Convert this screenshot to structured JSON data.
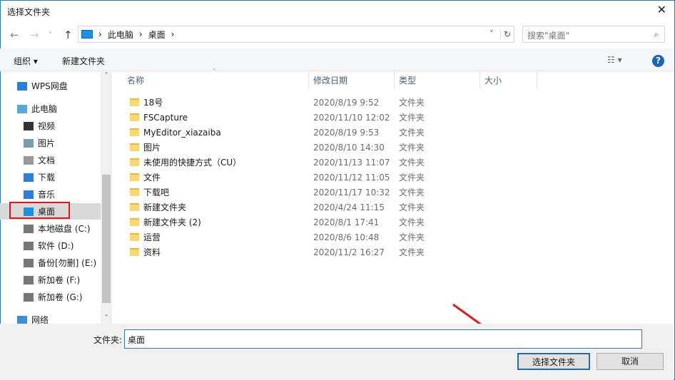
{
  "title": "选择文件夹",
  "address": {
    "crumbs": [
      "此电脑",
      "桌面"
    ],
    "search_placeholder": "搜索\"桌面\""
  },
  "toolbar": {
    "organize": "组织 ▾",
    "new_folder": "新建文件夹",
    "help": "?"
  },
  "sidebar": [
    {
      "label": "WPS网盘",
      "icon": "cloud-icon",
      "color": "#2a7fd6"
    },
    {
      "label": "此电脑",
      "icon": "computer-icon",
      "color": "#5aa7e0"
    },
    {
      "label": "视频",
      "icon": "video-icon",
      "color": "#333"
    },
    {
      "label": "图片",
      "icon": "picture-icon",
      "color": "#7a9bb0"
    },
    {
      "label": "文档",
      "icon": "document-icon",
      "color": "#999"
    },
    {
      "label": "下载",
      "icon": "download-icon",
      "color": "#2f7ed8"
    },
    {
      "label": "音乐",
      "icon": "music-icon",
      "color": "#2f7ed8"
    },
    {
      "label": "桌面",
      "icon": "desktop-icon",
      "color": "#1e90e0"
    },
    {
      "label": "本地磁盘 (C:)",
      "icon": "drive-icon",
      "color": "#777"
    },
    {
      "label": "软件 (D:)",
      "icon": "drive-icon",
      "color": "#777"
    },
    {
      "label": "备份[勿删] (E:)",
      "icon": "drive-icon",
      "color": "#777"
    },
    {
      "label": "新加卷 (F:)",
      "icon": "drive-icon",
      "color": "#777"
    },
    {
      "label": "新加卷 (G:)",
      "icon": "drive-icon",
      "color": "#777"
    },
    {
      "label": "网络",
      "icon": "network-icon",
      "color": "#3c8fd8"
    }
  ],
  "columns": [
    "名称",
    "修改日期",
    "类型",
    "大小"
  ],
  "files": [
    {
      "name": "18号",
      "date": "2020/8/19 9:52",
      "type": "文件夹"
    },
    {
      "name": "FSCapture",
      "date": "2020/11/10 12:02",
      "type": "文件夹"
    },
    {
      "name": "MyEditor_xiazaiba",
      "date": "2020/8/19 9:53",
      "type": "文件夹"
    },
    {
      "name": "图片",
      "date": "2020/8/10 14:30",
      "type": "文件夹"
    },
    {
      "name": "未使用的快捷方式（CU）",
      "date": "2020/11/13 11:07",
      "type": "文件夹"
    },
    {
      "name": "文件",
      "date": "2020/11/12 11:05",
      "type": "文件夹"
    },
    {
      "name": "下载吧",
      "date": "2020/11/17 10:32",
      "type": "文件夹"
    },
    {
      "name": "新建文件夹",
      "date": "2020/4/24 11:15",
      "type": "文件夹"
    },
    {
      "name": "新建文件夹 (2)",
      "date": "2020/8/1 17:41",
      "type": "文件夹"
    },
    {
      "name": "运营",
      "date": "2020/8/6 10:48",
      "type": "文件夹"
    },
    {
      "name": "资料",
      "date": "2020/11/2 16:27",
      "type": "文件夹"
    }
  ],
  "footer": {
    "folder_label": "文件夹:",
    "folder_value": "桌面",
    "select_button": "选择文件夹",
    "cancel_button": "取消"
  }
}
